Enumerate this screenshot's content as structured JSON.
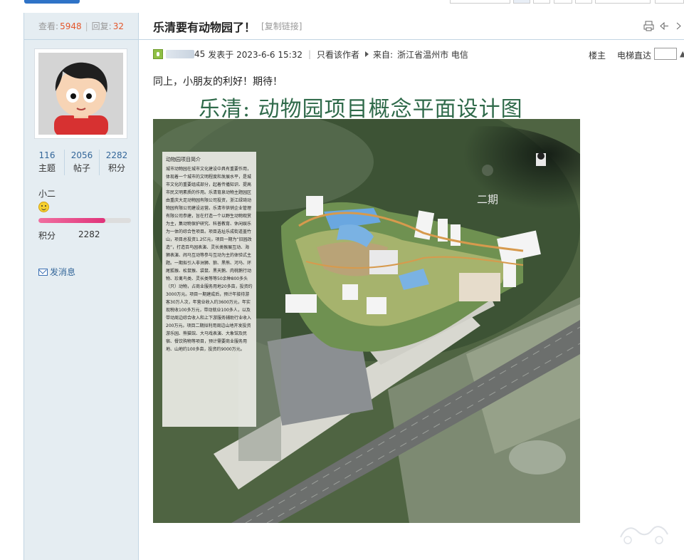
{
  "left": {
    "views_label": "查看:",
    "views": "5948",
    "replies_label": "回复:",
    "replies": "32",
    "stats": [
      {
        "value": "116",
        "label": "主题"
      },
      {
        "value": "2056",
        "label": "帖子"
      },
      {
        "value": "2282",
        "label": "积分"
      }
    ],
    "username": "小二",
    "level_fraction": 0.72,
    "points_label": "积分",
    "points_value": "2282",
    "send_msg": "发消息"
  },
  "post": {
    "title": "乐清要有动物园了！",
    "copy_link": "[复制链接]",
    "uid_suffix": "45",
    "posted_at": "发表于 2023-6-6 15:32",
    "author_only": "只看该作者",
    "from_label": "来自:",
    "from_value": "浙江省温州市 电信",
    "floor": "楼主",
    "elevator": "电梯直达",
    "text": "同上，小朋友的利好！期待！"
  },
  "plan_image": {
    "title": "乐清: 动物园项目概念平面设计图",
    "phase2": "二期",
    "note_title": "动物园项目简介",
    "note_body": "城市动物园在城市文化建设中具有重要作用，体现着一个城市的文明程度和发展水平，是城市文化的重要组成部分，起着传播知识、提高市民文明素质的作用。乐清育泉动物主题园区由重庆大足动物园有限公司投资，浙江绿琦动物园有限公司建设运营。乐清市供销企业管理有限公司参建，旨在打造一个以野生动物观赏为主，集动物保护研究、科普教育、休闲娱乐为一体的综合性项目。项目选址乐成街道盖竹山，项目总投资1.2亿元，项目一期为“旧园改造”，打造百鸟园表演、灵长类猴展互动、海狮表演、闹马互动等参与互动为主的体验式主题。一期拟引入非洲狮、狼、黑熊、河马、环尾狐猴、松鼠猴、袋鼠、黑天鹅、肉桃鹅行动物、珍禽鸟类、灵长类等等50余种800多头（只）动物，占商业服务用地20多亩，投资约3000万元。项目一期建成后，预计年接待游客30万人次，年营业收入约3600万元，年实现税收100多万元，带动就业100多人，以及带动周边综合收入和上下游服务辅助行业收入200万元。项目二期拟利用周边山地开发投资游乐园、熊猫馆、大马戏表演、大象馆及民宿、餐饮购物等项目，预计需要商业服务用地、山地约100多亩，投资约9000万元。"
  },
  "colors": {
    "accent": "#336699",
    "highlight": "#e4572c",
    "border": "#c2d5e3",
    "sidebar_bg": "#e5edf2"
  }
}
